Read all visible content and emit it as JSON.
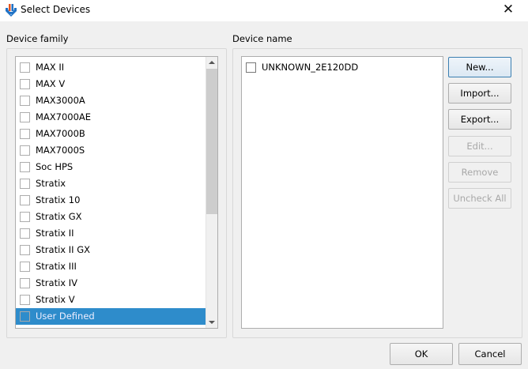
{
  "window": {
    "title": "Select Devices",
    "close_label": "✕"
  },
  "family": {
    "label": "Device family",
    "items": [
      "MAX II",
      "MAX V",
      "MAX3000A",
      "MAX7000AE",
      "MAX7000B",
      "MAX7000S",
      "Soc HPS",
      "Stratix",
      "Stratix 10",
      "Stratix GX",
      "Stratix II",
      "Stratix II GX",
      "Stratix III",
      "Stratix IV",
      "Stratix V",
      "User Defined"
    ],
    "selected": "User Defined"
  },
  "devices": {
    "label": "Device name",
    "items": [
      "UNKNOWN_2E120DD"
    ]
  },
  "buttons": {
    "new": "New...",
    "import": "Import...",
    "export": "Export...",
    "edit": "Edit...",
    "remove": "Remove",
    "uncheck_all": "Uncheck All",
    "ok": "OK",
    "cancel": "Cancel"
  }
}
